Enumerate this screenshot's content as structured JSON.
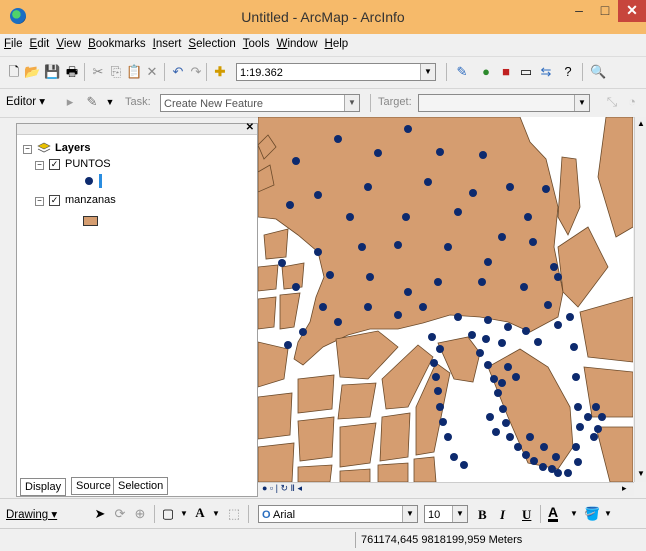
{
  "window": {
    "title": "Untitled - ArcMap - ArcInfo",
    "min": "–",
    "max": "□",
    "close": "✕"
  },
  "menu": [
    "File",
    "Edit",
    "View",
    "Bookmarks",
    "Insert",
    "Selection",
    "Tools",
    "Window",
    "Help"
  ],
  "standard_toolbar": {
    "scale": "1:19.362"
  },
  "editor_toolbar": {
    "editor_label": "Editor ▾",
    "task_label": "Task:",
    "task_value": "Create New Feature",
    "target_label": "Target:",
    "target_value": ""
  },
  "toc": {
    "root": "Layers",
    "layers": [
      {
        "name": "PUNTOS",
        "checked": true,
        "symbol_color": "#0d2a6e"
      },
      {
        "name": "manzanas",
        "checked": true,
        "symbol_color": "#d59d70"
      }
    ],
    "tabs": [
      "Display",
      "Source",
      "Selection"
    ]
  },
  "drawing_toolbar": {
    "drawing_label": "Drawing ▾",
    "font": "Arial",
    "font_size": "10",
    "bold": "B",
    "italic": "I",
    "underline": "U",
    "font_color_label": "A"
  },
  "status": {
    "coordinates": "761174,645  9818199,959 Meters"
  },
  "colors": {
    "title_bar": "#f6ba6a",
    "polygon_fill": "#d59d70",
    "polygon_stroke": "#6b4a2a",
    "point": "#0d2a6e",
    "close": "#c7453c"
  }
}
